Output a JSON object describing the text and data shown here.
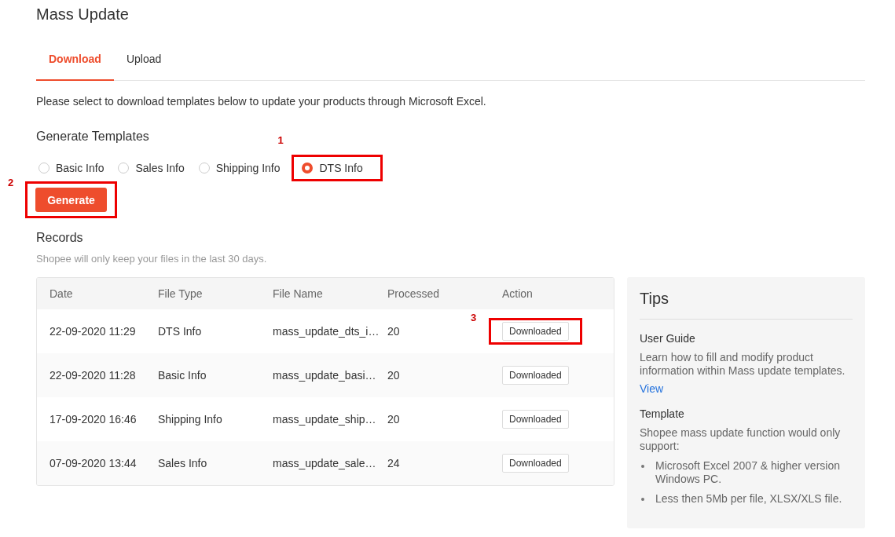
{
  "title": "Mass Update",
  "tabs": [
    {
      "label": "Download",
      "selected": true
    },
    {
      "label": "Upload",
      "selected": false
    }
  ],
  "intro": "Please select to download templates below to update your products through Microsoft Excel.",
  "generate_section": {
    "heading": "Generate Templates",
    "options": [
      {
        "label": "Basic Info",
        "selected": false
      },
      {
        "label": "Sales Info",
        "selected": false
      },
      {
        "label": "Shipping Info",
        "selected": false
      },
      {
        "label": "DTS Info",
        "selected": true,
        "callout": "1"
      }
    ],
    "button": {
      "label": "Generate",
      "callout": "2"
    }
  },
  "records": {
    "heading": "Records",
    "note": "Shopee will only keep your files in the last 30 days.",
    "columns": [
      "Date",
      "File Type",
      "File Name",
      "Processed",
      "Action"
    ],
    "rows": [
      {
        "date": "22-09-2020 11:29",
        "file_type": "DTS Info",
        "file_name": "mass_update_dts_i…",
        "processed": "20",
        "action": "Downloaded",
        "callout": "3"
      },
      {
        "date": "22-09-2020 11:28",
        "file_type": "Basic Info",
        "file_name": "mass_update_basi…",
        "processed": "20",
        "action": "Downloaded"
      },
      {
        "date": "17-09-2020 16:46",
        "file_type": "Shipping Info",
        "file_name": "mass_update_ship…",
        "processed": "20",
        "action": "Downloaded"
      },
      {
        "date": "07-09-2020 13:44",
        "file_type": "Sales Info",
        "file_name": "mass_update_sale…",
        "processed": "24",
        "action": "Downloaded"
      }
    ]
  },
  "tips": {
    "title": "Tips",
    "sections": [
      {
        "heading": "User Guide",
        "text": "Learn how to fill and modify product information within Mass update templates.",
        "link": "View"
      },
      {
        "heading": "Template",
        "text": "Shopee mass update function would only support:",
        "bullets": [
          "Microsoft Excel 2007 & higher version Windows PC.",
          "Less then 5Mb per file, XLSX/XLS file."
        ]
      }
    ]
  }
}
